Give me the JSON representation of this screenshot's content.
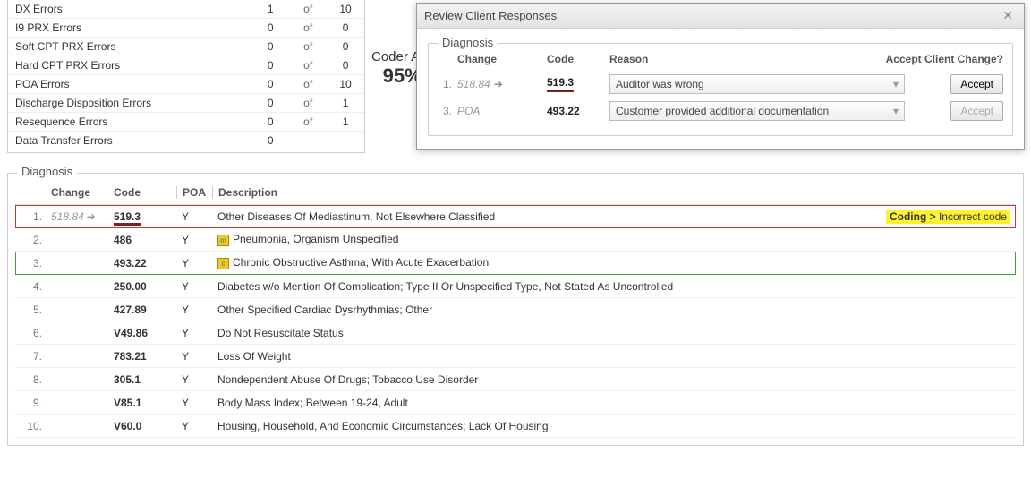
{
  "errors": [
    {
      "label": "DX Errors",
      "n": "1",
      "of": "of",
      "total": "10"
    },
    {
      "label": "I9 PRX Errors",
      "n": "0",
      "of": "of",
      "total": "0"
    },
    {
      "label": "Soft CPT PRX Errors",
      "n": "0",
      "of": "of",
      "total": "0"
    },
    {
      "label": "Hard CPT PRX Errors",
      "n": "0",
      "of": "of",
      "total": "0"
    },
    {
      "label": "POA Errors",
      "n": "0",
      "of": "of",
      "total": "10"
    },
    {
      "label": "Discharge Disposition Errors",
      "n": "0",
      "of": "of",
      "total": "1"
    },
    {
      "label": "Resequence Errors",
      "n": "0",
      "of": "of",
      "total": "1"
    },
    {
      "label": "Data Transfer Errors",
      "n": "0",
      "of": "",
      "total": ""
    }
  ],
  "coder_acc": {
    "label": "Coder Acc",
    "value": "95%"
  },
  "dialog": {
    "title": "Review Client Responses",
    "fieldset_label": "Diagnosis",
    "headers": {
      "change": "Change",
      "code": "Code",
      "reason": "Reason",
      "accept": "Accept Client Change?"
    },
    "rows": [
      {
        "idx": "1.",
        "change_old": "518.84",
        "code": "519.3",
        "reason": "Auditor was wrong",
        "accept_label": "Accept",
        "disabled": false,
        "underline": true,
        "poa": false
      },
      {
        "idx": "3.",
        "change_old": "POA",
        "code": "493.22",
        "reason": "Customer provided additional documentation",
        "accept_label": "Accept",
        "disabled": true,
        "underline": false,
        "poa": true
      }
    ]
  },
  "diagnosis": {
    "legend": "Diagnosis",
    "headers": {
      "change": "Change",
      "code": "Code",
      "poa": "POA",
      "desc": "Description"
    },
    "rows": [
      {
        "idx": "1.",
        "change_old": "518.84",
        "code": "519.3",
        "poa": "Y",
        "desc": "Other Diseases Of Mediastinum, Not Elsewhere Classified",
        "badge": "Coding > Incorrect code",
        "hl": "red",
        "icon": ""
      },
      {
        "idx": "2.",
        "change_old": "",
        "code": "486",
        "poa": "Y",
        "desc": "Pneumonia, Organism Unspecified",
        "badge": "",
        "hl": "",
        "icon": "m"
      },
      {
        "idx": "3.",
        "change_old": "",
        "code": "493.22",
        "poa": "Y",
        "desc": "Chronic Obstructive Asthma, With Acute Exacerbation",
        "badge": "",
        "hl": "green",
        "icon": "c"
      },
      {
        "idx": "4.",
        "change_old": "",
        "code": "250.00",
        "poa": "Y",
        "desc": "Diabetes w/o Mention Of Complication; Type II Or Unspecified Type, Not Stated As Uncontrolled",
        "badge": "",
        "hl": "",
        "icon": ""
      },
      {
        "idx": "5.",
        "change_old": "",
        "code": "427.89",
        "poa": "Y",
        "desc": "Other Specified Cardiac Dysrhythmias; Other",
        "badge": "",
        "hl": "",
        "icon": ""
      },
      {
        "idx": "6.",
        "change_old": "",
        "code": "V49.86",
        "poa": "Y",
        "desc": "Do Not Resuscitate Status",
        "badge": "",
        "hl": "",
        "icon": ""
      },
      {
        "idx": "7.",
        "change_old": "",
        "code": "783.21",
        "poa": "Y",
        "desc": "Loss Of Weight",
        "badge": "",
        "hl": "",
        "icon": ""
      },
      {
        "idx": "8.",
        "change_old": "",
        "code": "305.1",
        "poa": "Y",
        "desc": "Nondependent Abuse Of Drugs; Tobacco Use Disorder",
        "badge": "",
        "hl": "",
        "icon": ""
      },
      {
        "idx": "9.",
        "change_old": "",
        "code": "V85.1",
        "poa": "Y",
        "desc": "Body Mass Index; Between 19-24, Adult",
        "badge": "",
        "hl": "",
        "icon": ""
      },
      {
        "idx": "10.",
        "change_old": "",
        "code": "V60.0",
        "poa": "Y",
        "desc": "Housing, Household, And Economic Circumstances; Lack Of Housing",
        "badge": "",
        "hl": "",
        "icon": ""
      }
    ]
  }
}
